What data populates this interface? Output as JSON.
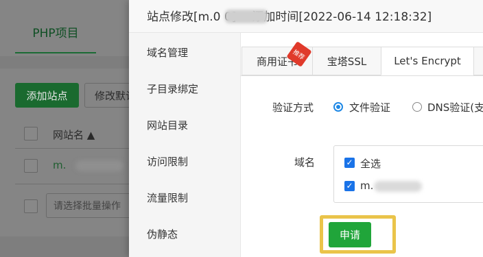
{
  "background_page": {
    "tab_label": "PHP项目",
    "add_site_button": "添加站点",
    "modify_default_button": "修改默认",
    "table_header": "网站名 ▲",
    "row_site_name": "m.",
    "batch_select_placeholder": "请选择批量操作"
  },
  "modal": {
    "title": "站点修改[m.0          0] -- 添加时间[2022-06-14 12:18:32]",
    "sidebar": {
      "items": [
        {
          "label": "域名管理"
        },
        {
          "label": "子目录绑定"
        },
        {
          "label": "网站目录"
        },
        {
          "label": "访问限制"
        },
        {
          "label": "流量限制"
        },
        {
          "label": "伪静态"
        }
      ]
    },
    "tabs": [
      {
        "label": "商用证书",
        "active": false
      },
      {
        "label": "宝塔SSL",
        "active": false
      },
      {
        "label": "Let's Encrypt",
        "active": true
      }
    ],
    "recommend_badge": "推荐",
    "verify": {
      "label": "验证方式",
      "options": [
        {
          "label": "文件验证",
          "selected": true
        },
        {
          "label": "DNS验证(支",
          "selected": false
        }
      ]
    },
    "domain": {
      "label": "域名",
      "select_all": "全选",
      "item": "m."
    },
    "apply_button": "申请",
    "colors": {
      "accent_green": "#20a53a",
      "highlight": "#eac44a",
      "checkbox_blue": "#1a73e8"
    }
  }
}
